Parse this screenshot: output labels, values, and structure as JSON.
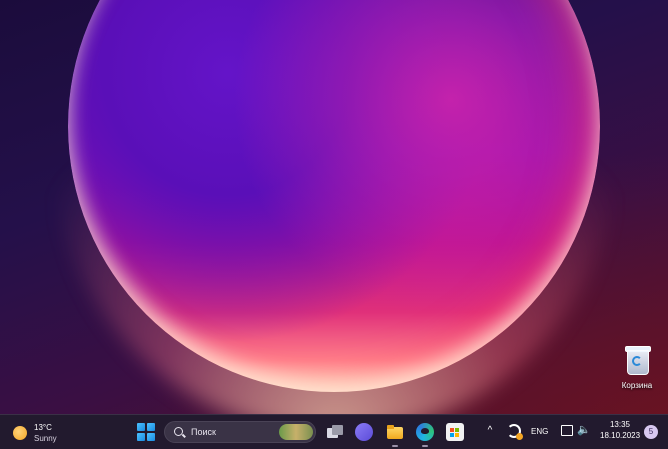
{
  "desktop": {
    "wallpaper": "Windows 11 bloom wallpaper",
    "icons": [
      {
        "label": "Корзина",
        "icon": "recycle-bin-icon"
      }
    ]
  },
  "taskbar": {
    "weather": {
      "temperature": "13°C",
      "condition": "Sunny",
      "icon": "sun-icon"
    },
    "search": {
      "placeholder": "Поиск"
    },
    "pinned": [
      {
        "name": "Task View",
        "icon": "task-view-icon"
      },
      {
        "name": "Teams Chat",
        "icon": "teams-icon"
      },
      {
        "name": "File Explorer",
        "icon": "folder-icon"
      },
      {
        "name": "Microsoft Edge",
        "icon": "edge-icon"
      },
      {
        "name": "Microsoft Store",
        "icon": "store-icon"
      }
    ],
    "tray": {
      "language": "ENG",
      "time": "13:35",
      "date": "18.10.2023",
      "notification_count": "5"
    }
  },
  "colors": {
    "accent": "#4cc2ff",
    "taskbar_bg": "#221a2e"
  }
}
